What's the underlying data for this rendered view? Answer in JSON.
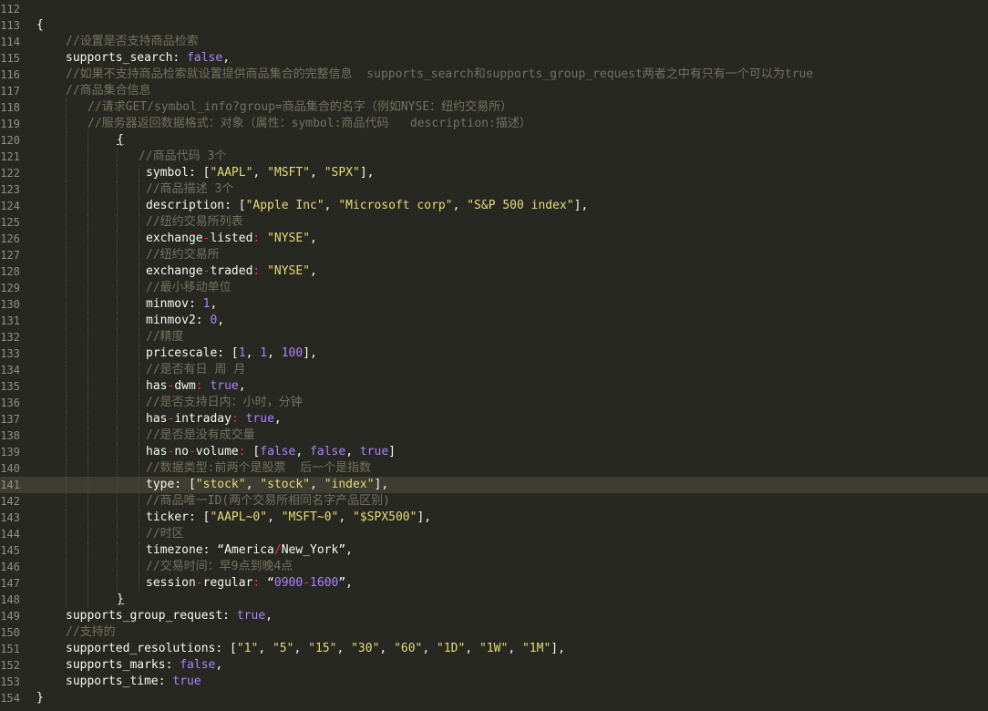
{
  "editor": {
    "theme_colors": {
      "background": "#272822",
      "text": "#f8f8f2",
      "comment": "#75715e",
      "string": "#e6db74",
      "constant": "#ae81ff",
      "operator": "#f92672",
      "gutter": "#90908a",
      "current_line": "#3e3d32"
    },
    "current_line_number": "141",
    "lines": [
      {
        "num": "112",
        "indent": 0,
        "tokens": []
      },
      {
        "num": "113",
        "indent": 0,
        "tokens": [
          {
            "t": "{",
            "k": "p"
          }
        ]
      },
      {
        "num": "114",
        "indent": 1,
        "tokens": [
          {
            "t": "//设置是否支持商品检索",
            "k": "c"
          }
        ]
      },
      {
        "num": "115",
        "indent": 1,
        "tokens": [
          {
            "t": "supports_search: ",
            "k": "p"
          },
          {
            "t": "false",
            "k": "n"
          },
          {
            "t": ",",
            "k": "p"
          }
        ]
      },
      {
        "num": "116",
        "indent": 1,
        "tokens": [
          {
            "t": "//如果不支持商品检索就设置提供商品集合的完整信息  supports_search和supports_group_request两者之中有只有一个可以为true",
            "k": "c"
          }
        ]
      },
      {
        "num": "117",
        "indent": 1,
        "tokens": [
          {
            "t": "//商品集合信息",
            "k": "c"
          }
        ]
      },
      {
        "num": "118",
        "indent": 2,
        "tokens": [
          {
            "t": "//请求GET/symbol_info?group=商品集合的名字（例如NYSE：纽约交易所）",
            "k": "c"
          }
        ]
      },
      {
        "num": "119",
        "indent": 2,
        "tokens": [
          {
            "t": "//服务器返回数据格式：对象（属性：symbol:商品代码   description:描述）",
            "k": "c"
          }
        ]
      },
      {
        "num": "120",
        "indent": 3,
        "tokens": [
          {
            "t": "{",
            "k": "p",
            "u": true
          }
        ]
      },
      {
        "num": "121",
        "indent": 4,
        "tokens": [
          {
            "t": "//商品代码 3个",
            "k": "c"
          }
        ]
      },
      {
        "num": "122",
        "indent": 5,
        "tokens": [
          {
            "t": "symbol: [",
            "k": "p"
          },
          {
            "t": "\"AAPL\"",
            "k": "s"
          },
          {
            "t": ", ",
            "k": "p"
          },
          {
            "t": "\"MSFT\"",
            "k": "s"
          },
          {
            "t": ", ",
            "k": "p"
          },
          {
            "t": "\"SPX\"",
            "k": "s"
          },
          {
            "t": "],",
            "k": "p"
          }
        ]
      },
      {
        "num": "123",
        "indent": 5,
        "tokens": [
          {
            "t": "//商品描述 3个",
            "k": "c"
          }
        ]
      },
      {
        "num": "124",
        "indent": 5,
        "tokens": [
          {
            "t": "description: [",
            "k": "p"
          },
          {
            "t": "\"Apple Inc\"",
            "k": "s"
          },
          {
            "t": ", ",
            "k": "p"
          },
          {
            "t": "\"Microsoft corp\"",
            "k": "s"
          },
          {
            "t": ", ",
            "k": "p"
          },
          {
            "t": "\"S&P 500 index\"",
            "k": "s"
          },
          {
            "t": "],",
            "k": "p"
          }
        ]
      },
      {
        "num": "125",
        "indent": 5,
        "tokens": [
          {
            "t": "//纽约交易所列表",
            "k": "c"
          }
        ]
      },
      {
        "num": "126",
        "indent": 5,
        "tokens": [
          {
            "t": "exchange",
            "k": "p"
          },
          {
            "t": "-",
            "k": "o"
          },
          {
            "t": "listed",
            "k": "p"
          },
          {
            "t": ": ",
            "k": "o"
          },
          {
            "t": "\"NYSE\"",
            "k": "s"
          },
          {
            "t": ",",
            "k": "p"
          }
        ]
      },
      {
        "num": "127",
        "indent": 5,
        "tokens": [
          {
            "t": "//纽约交易所",
            "k": "c"
          }
        ]
      },
      {
        "num": "128",
        "indent": 5,
        "tokens": [
          {
            "t": "exchange",
            "k": "p"
          },
          {
            "t": "-",
            "k": "o"
          },
          {
            "t": "traded",
            "k": "p"
          },
          {
            "t": ": ",
            "k": "o"
          },
          {
            "t": "\"NYSE\"",
            "k": "s"
          },
          {
            "t": ",",
            "k": "p"
          }
        ]
      },
      {
        "num": "129",
        "indent": 5,
        "tokens": [
          {
            "t": "//最小移动单位",
            "k": "c"
          }
        ]
      },
      {
        "num": "130",
        "indent": 5,
        "tokens": [
          {
            "t": "minmov: ",
            "k": "p"
          },
          {
            "t": "1",
            "k": "n"
          },
          {
            "t": ",",
            "k": "p"
          }
        ]
      },
      {
        "num": "131",
        "indent": 5,
        "tokens": [
          {
            "t": "minmov2: ",
            "k": "p"
          },
          {
            "t": "0",
            "k": "n"
          },
          {
            "t": ",",
            "k": "p"
          }
        ]
      },
      {
        "num": "132",
        "indent": 5,
        "tokens": [
          {
            "t": "//精度",
            "k": "c"
          }
        ]
      },
      {
        "num": "133",
        "indent": 5,
        "tokens": [
          {
            "t": "pricescale: [",
            "k": "p"
          },
          {
            "t": "1",
            "k": "n"
          },
          {
            "t": ", ",
            "k": "p"
          },
          {
            "t": "1",
            "k": "n"
          },
          {
            "t": ", ",
            "k": "p"
          },
          {
            "t": "100",
            "k": "n"
          },
          {
            "t": "],",
            "k": "p"
          }
        ]
      },
      {
        "num": "134",
        "indent": 5,
        "tokens": [
          {
            "t": "//是否有日 周 月",
            "k": "c"
          }
        ]
      },
      {
        "num": "135",
        "indent": 5,
        "tokens": [
          {
            "t": "has",
            "k": "p"
          },
          {
            "t": "-",
            "k": "o"
          },
          {
            "t": "dwm",
            "k": "p"
          },
          {
            "t": ": ",
            "k": "o"
          },
          {
            "t": "true",
            "k": "n"
          },
          {
            "t": ",",
            "k": "p"
          }
        ]
      },
      {
        "num": "136",
        "indent": 5,
        "tokens": [
          {
            "t": "//是否支持日内：小时，分钟",
            "k": "c"
          }
        ]
      },
      {
        "num": "137",
        "indent": 5,
        "tokens": [
          {
            "t": "has",
            "k": "p"
          },
          {
            "t": "-",
            "k": "o"
          },
          {
            "t": "intraday",
            "k": "p"
          },
          {
            "t": ": ",
            "k": "o"
          },
          {
            "t": "true",
            "k": "n"
          },
          {
            "t": ",",
            "k": "p"
          }
        ]
      },
      {
        "num": "138",
        "indent": 5,
        "tokens": [
          {
            "t": "//是否是没有成交量",
            "k": "c"
          }
        ]
      },
      {
        "num": "139",
        "indent": 5,
        "tokens": [
          {
            "t": "has",
            "k": "p"
          },
          {
            "t": "-",
            "k": "o"
          },
          {
            "t": "no",
            "k": "p"
          },
          {
            "t": "-",
            "k": "o"
          },
          {
            "t": "volume",
            "k": "p"
          },
          {
            "t": ": ",
            "k": "o"
          },
          {
            "t": "[",
            "k": "p"
          },
          {
            "t": "false",
            "k": "n"
          },
          {
            "t": ", ",
            "k": "p"
          },
          {
            "t": "false",
            "k": "n"
          },
          {
            "t": ", ",
            "k": "p"
          },
          {
            "t": "true",
            "k": "n"
          },
          {
            "t": "]",
            "k": "p"
          }
        ]
      },
      {
        "num": "140",
        "indent": 5,
        "tokens": [
          {
            "t": "//数据类型:前两个是股票  后一个是指数",
            "k": "c"
          }
        ]
      },
      {
        "num": "141",
        "indent": 5,
        "tokens": [
          {
            "t": "type: [",
            "k": "p"
          },
          {
            "t": "\"stock\"",
            "k": "s"
          },
          {
            "t": ", ",
            "k": "p"
          },
          {
            "t": "\"stock\"",
            "k": "s"
          },
          {
            "t": ", ",
            "k": "p"
          },
          {
            "t": "\"index\"",
            "k": "s"
          },
          {
            "t": "],",
            "k": "p"
          }
        ]
      },
      {
        "num": "142",
        "indent": 5,
        "tokens": [
          {
            "t": "//商品唯一ID(两个交易所相同名字产品区别)",
            "k": "c"
          }
        ]
      },
      {
        "num": "143",
        "indent": 5,
        "tokens": [
          {
            "t": "ticker: [",
            "k": "p"
          },
          {
            "t": "\"AAPL~0\"",
            "k": "s"
          },
          {
            "t": ", ",
            "k": "p"
          },
          {
            "t": "\"MSFT~0\"",
            "k": "s"
          },
          {
            "t": ", ",
            "k": "p"
          },
          {
            "t": "\"$SPX500\"",
            "k": "s"
          },
          {
            "t": "],",
            "k": "p"
          }
        ]
      },
      {
        "num": "144",
        "indent": 5,
        "tokens": [
          {
            "t": "//时区",
            "k": "c"
          }
        ]
      },
      {
        "num": "145",
        "indent": 5,
        "tokens": [
          {
            "t": "timezone: “America",
            "k": "p"
          },
          {
            "t": "/",
            "k": "o"
          },
          {
            "t": "New_York”,",
            "k": "p"
          }
        ]
      },
      {
        "num": "146",
        "indent": 5,
        "tokens": [
          {
            "t": "//交易时间：早9点到晚4点",
            "k": "c"
          }
        ]
      },
      {
        "num": "147",
        "indent": 5,
        "tokens": [
          {
            "t": "session",
            "k": "p"
          },
          {
            "t": "-",
            "k": "o"
          },
          {
            "t": "regular",
            "k": "p"
          },
          {
            "t": ": ",
            "k": "o"
          },
          {
            "t": "“",
            "k": "p"
          },
          {
            "t": "0900",
            "k": "n"
          },
          {
            "t": "-",
            "k": "o"
          },
          {
            "t": "1600",
            "k": "n"
          },
          {
            "t": "”,",
            "k": "p"
          }
        ]
      },
      {
        "num": "148",
        "indent": 3,
        "tokens": [
          {
            "t": "}",
            "k": "p",
            "u": true
          }
        ]
      },
      {
        "num": "149",
        "indent": 1,
        "tokens": [
          {
            "t": "supports_group_request: ",
            "k": "p"
          },
          {
            "t": "true",
            "k": "n"
          },
          {
            "t": ",",
            "k": "p"
          }
        ]
      },
      {
        "num": "150",
        "indent": 1,
        "tokens": [
          {
            "t": "//支持的",
            "k": "c"
          }
        ]
      },
      {
        "num": "151",
        "indent": 1,
        "tokens": [
          {
            "t": "supported_resolutions: [",
            "k": "p"
          },
          {
            "t": "\"1\"",
            "k": "s"
          },
          {
            "t": ", ",
            "k": "p"
          },
          {
            "t": "\"5\"",
            "k": "s"
          },
          {
            "t": ", ",
            "k": "p"
          },
          {
            "t": "\"15\"",
            "k": "s"
          },
          {
            "t": ", ",
            "k": "p"
          },
          {
            "t": "\"30\"",
            "k": "s"
          },
          {
            "t": ", ",
            "k": "p"
          },
          {
            "t": "\"60\"",
            "k": "s"
          },
          {
            "t": ", ",
            "k": "p"
          },
          {
            "t": "\"1D\"",
            "k": "s"
          },
          {
            "t": ", ",
            "k": "p"
          },
          {
            "t": "\"1W\"",
            "k": "s"
          },
          {
            "t": ", ",
            "k": "p"
          },
          {
            "t": "\"1M\"",
            "k": "s"
          },
          {
            "t": "],",
            "k": "p"
          }
        ]
      },
      {
        "num": "152",
        "indent": 1,
        "tokens": [
          {
            "t": "supports_marks: ",
            "k": "p"
          },
          {
            "t": "false",
            "k": "n"
          },
          {
            "t": ",",
            "k": "p"
          }
        ]
      },
      {
        "num": "153",
        "indent": 1,
        "tokens": [
          {
            "t": "supports_time: ",
            "k": "p"
          },
          {
            "t": "true",
            "k": "n"
          }
        ]
      },
      {
        "num": "154",
        "indent": 0,
        "tokens": [
          {
            "t": "}",
            "k": "p"
          }
        ]
      }
    ]
  }
}
